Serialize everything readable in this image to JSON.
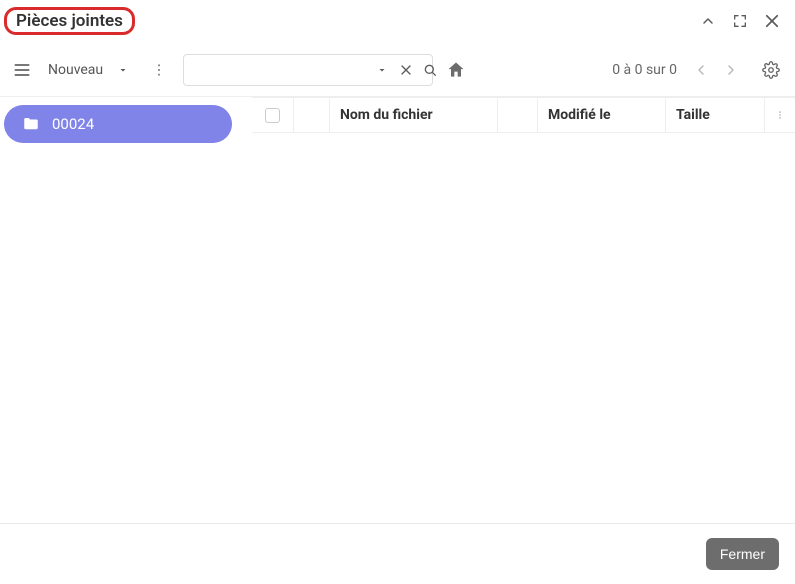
{
  "title": "Pièces jointes",
  "toolbar": {
    "new_label": "Nouveau",
    "counter": "0 à 0 sur 0"
  },
  "sidebar": {
    "folder_label": "00024"
  },
  "columns": {
    "name": "Nom du fichier",
    "modified": "Modifié le",
    "size": "Taille"
  },
  "footer": {
    "close_label": "Fermer"
  }
}
